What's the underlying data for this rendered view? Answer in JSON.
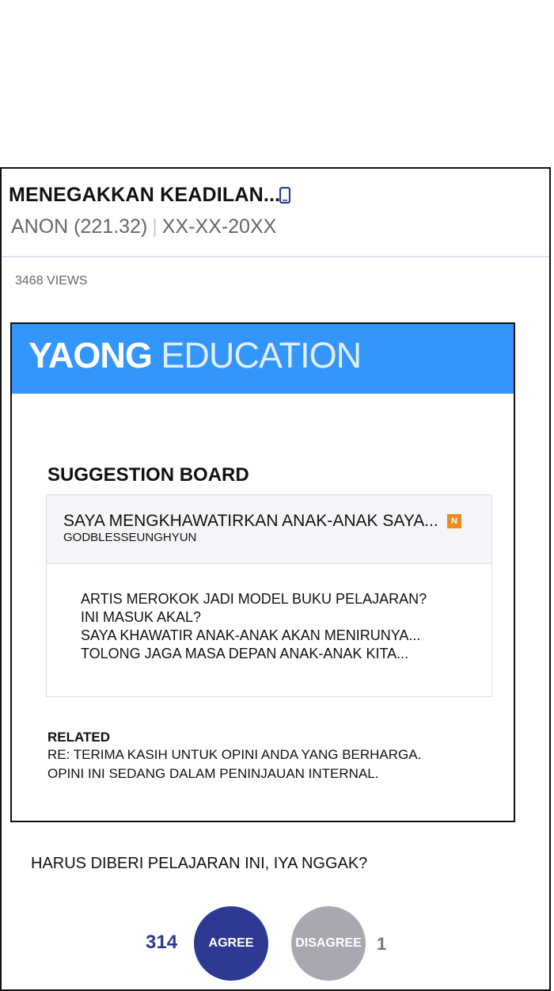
{
  "post": {
    "title": "MENEGAKKAN KEADILAN...",
    "author": "ANON (221.32)",
    "separator": "|",
    "date": "XX-XX-20XX",
    "views": "3468 VIEWS",
    "device_icon": "mobile-phone-icon"
  },
  "article": {
    "brand_strong": "YAONG",
    "brand_light": "EDUCATION",
    "brand_color": "#3396fa",
    "board_title": "SUGGESTION BOARD",
    "card": {
      "title": "SAYA MENGKHAWATIRKAN ANAK-ANAK SAYA...",
      "badge": "N",
      "author": "GODBLESSEUNGHYUN",
      "body": [
        "ARTIS MEROKOK JADI MODEL BUKU PELAJARAN?",
        "INI MASUK AKAL?",
        "SAYA KHAWATIR ANAK-ANAK AKAN MENIRUNYA...",
        "TOLONG JAGA MASA DEPAN ANAK-ANAK KITA..."
      ]
    },
    "related": {
      "label": "RELATED",
      "lines": [
        "RE: TERIMA KASIH UNTUK OPINI ANDA YANG BERHARGA.",
        "OPINI INI SEDANG DALAM PENINJAUAN INTERNAL."
      ]
    }
  },
  "poll": {
    "question": "HARUS DIBERI PELAJARAN INI, IYA NGGAK?",
    "agree_label": "AGREE",
    "agree_count": "314",
    "disagree_label": "DISAGREE",
    "disagree_count": "1",
    "agree_color": "#2e3a92",
    "disagree_color": "#a9a8b1"
  }
}
